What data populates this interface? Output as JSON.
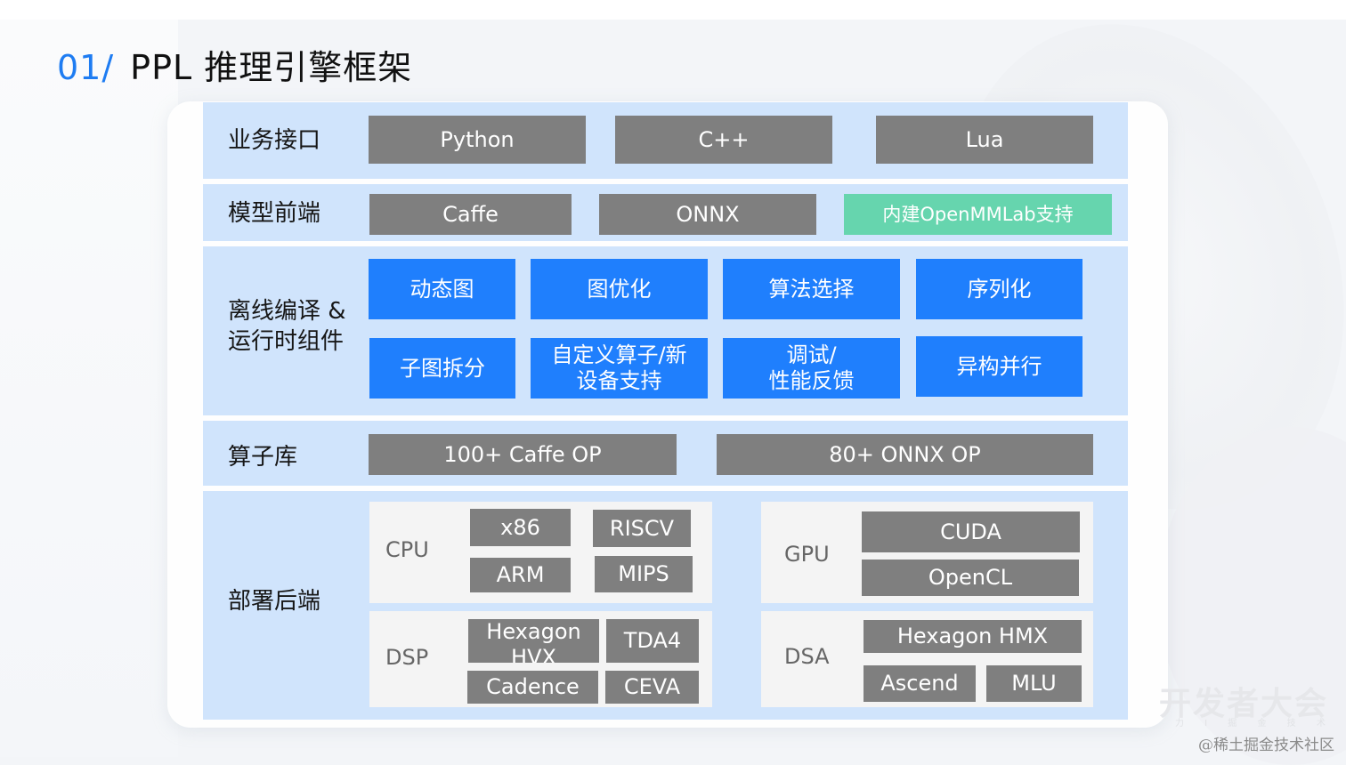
{
  "title": {
    "number": "01/",
    "text": "PPL 推理引擎框架"
  },
  "colors": {
    "accent_blue": "#1e7cf2",
    "layer_bg": "#d0e4fc",
    "gray_box": "#7f7f7f",
    "blue_box": "#1f7ffd",
    "green_box": "#66d5ae"
  },
  "layers": {
    "api": {
      "label": "业务接口",
      "items": [
        "Python",
        "C++",
        "Lua"
      ]
    },
    "frontend": {
      "label": "模型前端",
      "items": [
        "Caffe",
        "ONNX",
        "内建OpenMMLab支持"
      ]
    },
    "runtime": {
      "label_line1": "离线编译 &",
      "label_line2": "运行时组件",
      "items": [
        "动态图",
        "图优化",
        "算法选择",
        "序列化",
        "子图拆分",
        "自定义算子/新设备支持",
        "调试/性能反馈",
        "异构并行"
      ],
      "items_display": {
        "custom_op_line1": "自定义算子/新",
        "custom_op_line2": "设备支持",
        "debug_line1": "调试/",
        "debug_line2": "性能反馈"
      }
    },
    "ops": {
      "label": "算子库",
      "items": [
        "100+ Caffe OP",
        "80+ ONNX OP"
      ]
    },
    "backend": {
      "label": "部署后端",
      "groups": {
        "cpu": {
          "label": "CPU",
          "items": [
            "x86",
            "RISCV",
            "ARM",
            "MIPS"
          ]
        },
        "gpu": {
          "label": "GPU",
          "items": [
            "CUDA",
            "OpenCL"
          ]
        },
        "dsp": {
          "label": "DSP",
          "items": [
            "Hexagon HVX",
            "TDA4",
            "Cadence",
            "CEVA"
          ],
          "hexagon_line1": "Hexagon",
          "hexagon_line2": "HVX"
        },
        "dsa": {
          "label": "DSA",
          "items": [
            "Hexagon HMX",
            "Ascend",
            "MLU"
          ]
        }
      }
    }
  },
  "watermark": {
    "event": "开发者大会",
    "credit": "@稀土掘金技术社区"
  }
}
